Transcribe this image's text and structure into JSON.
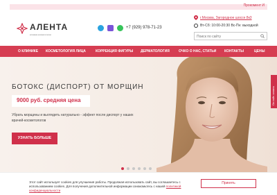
{
  "promo": {
    "link_label": "Прокомент И"
  },
  "header": {
    "logo": {
      "name": "АЛЕНТА",
      "subtitle": "клиника косметологии"
    },
    "phone": "+7 (929) 978-71-23",
    "address": "г.Москва, Загородное шоссе 8к3",
    "hours": "Вт-Сб: 10:00-20:30 Вс-Пн: выходной",
    "search_placeholder": "Поиск по сайту"
  },
  "nav": {
    "items": [
      "О КЛИНИКЕ",
      "КОСМЕТОЛОГИЯ ЛИЦА",
      "КОРРЕКЦИЯ ФИГУРЫ",
      "ДЕРМАТОЛОГИЯ",
      "ОЧКО О НАС, СТАТЬИ",
      "КОНТАКТЫ",
      "ЦЕНЫ"
    ]
  },
  "hero": {
    "title": "БОТОКС (ДИСПОРТ) ОТ МОРЩИН",
    "price": "9000 руб. средняя цена",
    "description": "Убрать морщины и выглядеть натурально - эффект после диспорт у наших врачей-косметологов",
    "cta_label": "УЗНАТЬ БОЛЬШЕ",
    "slides_total": 6,
    "active_slide": 1
  },
  "side_tab": {
    "label": "Онлайн-запись"
  },
  "cookie": {
    "text": "Этот сайт использует cookies для улучшения работы. Продолжая использовать сайт, вы соглашаетесь с использованием cookies. Для получения дополнительной информации ознакомьтесь с нашей",
    "link_label": "политикой конфиденциальности",
    "accept_label": "Принять"
  },
  "colors": {
    "brand": "#d0304a",
    "nav_bg": "#d63d52",
    "hero_bg": "#f7efe9"
  },
  "icons": [
    "telegram-icon",
    "viber-icon",
    "whatsapp-icon",
    "map-pin-icon",
    "clock-icon",
    "search-icon"
  ]
}
